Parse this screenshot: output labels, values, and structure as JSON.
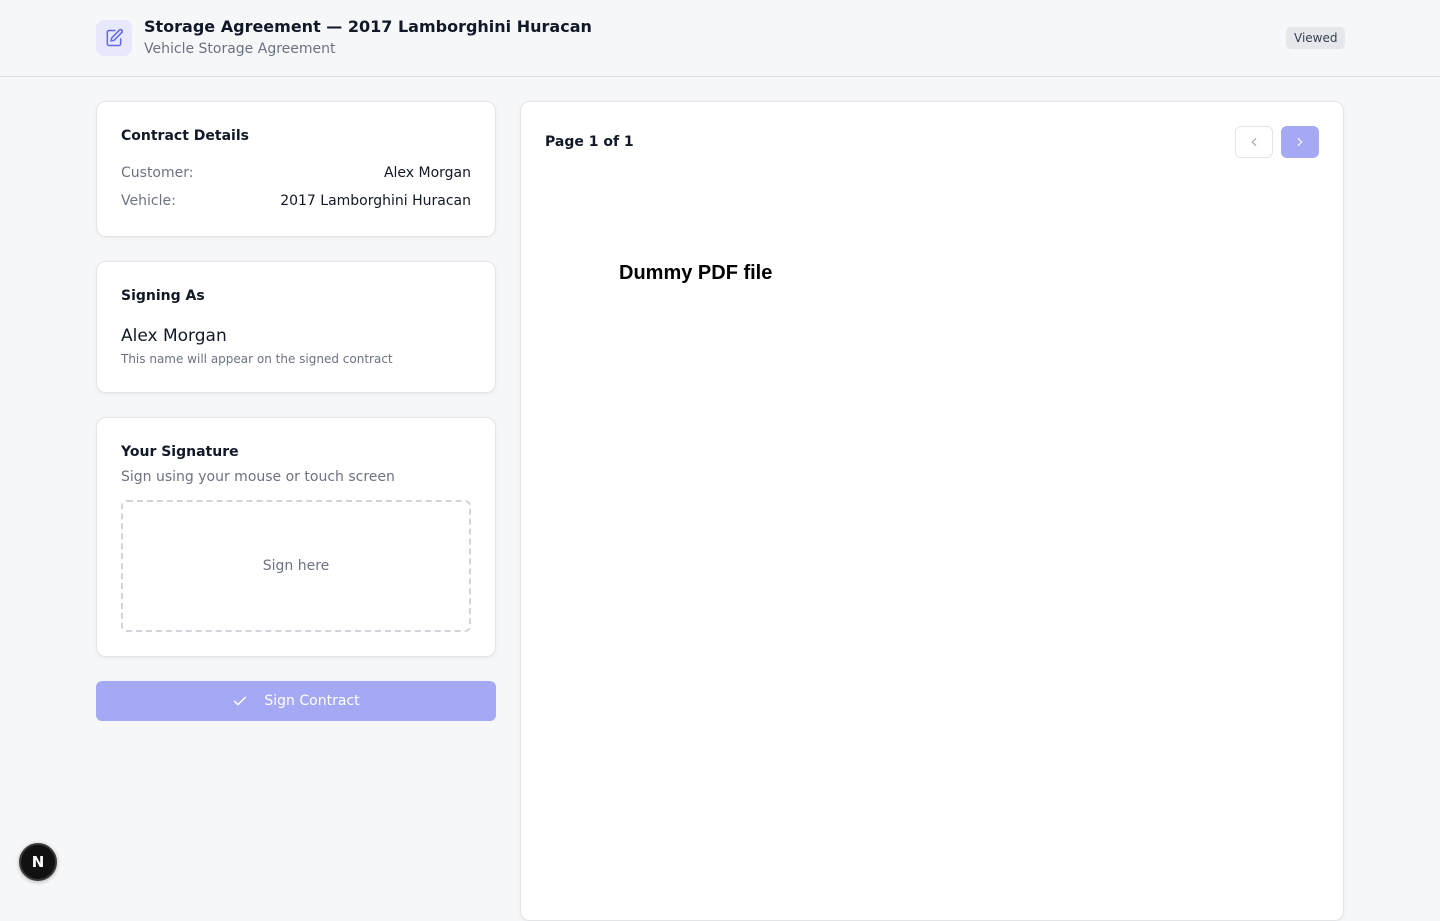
{
  "header": {
    "title": "Storage Agreement — 2017 Lamborghini Huracan",
    "subtitle": "Vehicle Storage Agreement",
    "status": "Viewed",
    "icon": "document-edit-icon"
  },
  "contract_details": {
    "title": "Contract Details",
    "customer_label": "Customer:",
    "customer_value": "Alex Morgan",
    "vehicle_label": "Vehicle:",
    "vehicle_value": "2017 Lamborghini Huracan"
  },
  "signing_as": {
    "title": "Signing As",
    "name": "Alex Morgan",
    "hint": "This name will appear on the signed contract"
  },
  "signature": {
    "title": "Your Signature",
    "description": "Sign using your mouse or touch screen",
    "placeholder": "Sign here"
  },
  "sign_button": {
    "label": "Sign Contract",
    "icon": "check-icon"
  },
  "pdf_viewer": {
    "page_indicator": "Page 1 of 1",
    "prev_icon": "chevron-left-icon",
    "next_icon": "chevron-right-icon",
    "heading": "Dummy PDF file"
  },
  "dev_badge": {
    "label": "N"
  },
  "colors": {
    "accent": "#a5a9f4",
    "accent_icon": "#6366f1",
    "background": "#f6f7f9",
    "card": "#ffffff"
  }
}
